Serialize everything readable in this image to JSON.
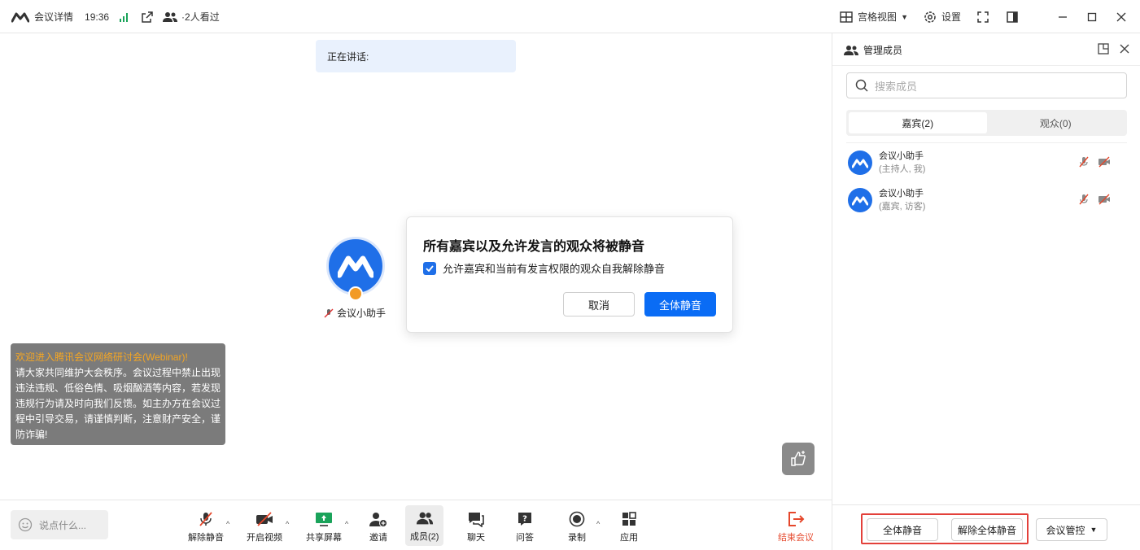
{
  "titlebar": {
    "meeting_details": "会议详情",
    "time": "19:36",
    "viewers": "·2人看过",
    "grid_view": "宫格视图",
    "settings": "设置"
  },
  "stage": {
    "speaking_label": "正在讲话:",
    "participant_name": "会议小助手",
    "notice_title": "欢迎进入腾讯会议网络研讨会(Webinar)!",
    "notice_body": "请大家共同维护大会秩序。会议过程中禁止出现违法违规、低俗色情、吸烟酗酒等内容，若发现违规行为请及时向我们反馈。如主办方在会议过程中引导交易，请谨慎判断，注意财产安全，谨防诈骗!"
  },
  "dialog": {
    "title": "所有嘉宾以及允许发言的观众将被静音",
    "checkbox_label": "允许嘉宾和当前有发言权限的观众自我解除静音",
    "checkbox_checked": true,
    "cancel": "取消",
    "confirm": "全体静音"
  },
  "toolbar": {
    "chat_placeholder": "说点什么...",
    "unmute": "解除静音",
    "start_video": "开启视频",
    "share_screen": "共享屏幕",
    "invite": "邀请",
    "members": "成员(2)",
    "chat": "聊天",
    "qa": "问答",
    "record": "录制",
    "apps": "应用",
    "end_meeting": "结束会议"
  },
  "panel": {
    "title": "管理成员",
    "search_placeholder": "搜索成员",
    "tabs": [
      {
        "label": "嘉宾(2)",
        "active": true
      },
      {
        "label": "观众(0)",
        "active": false
      }
    ],
    "members": [
      {
        "name": "会议小助手",
        "role": "(主持人, 我)"
      },
      {
        "name": "会议小助手",
        "role": "(嘉宾, 访客)"
      }
    ],
    "mute_all": "全体静音",
    "unmute_all": "解除全体静音",
    "meeting_control": "会议管控"
  },
  "colors": {
    "accent": "#0a6cf5",
    "danger": "#e5472b",
    "notice_title": "#f5a623",
    "highlight_border": "#e3403a"
  }
}
